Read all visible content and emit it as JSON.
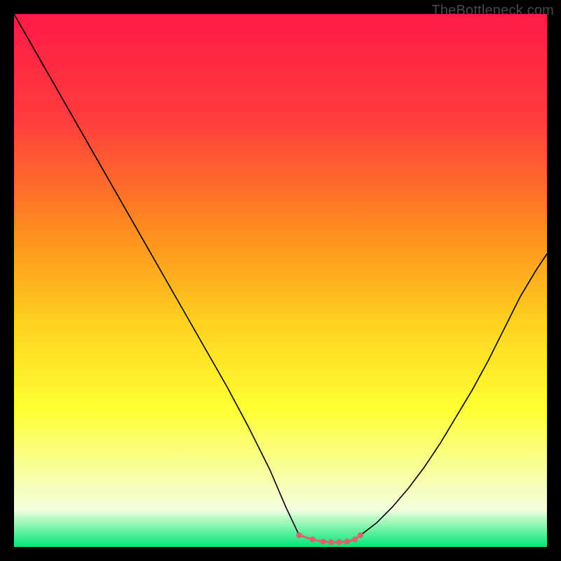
{
  "watermark": "TheBottleneck.com",
  "chart_data": {
    "type": "line",
    "title": "",
    "xlabel": "",
    "ylabel": "",
    "xlim": [
      0,
      100
    ],
    "ylim": [
      0,
      100
    ],
    "gradient_stops": [
      {
        "offset": 0,
        "color": "#ff1a47"
      },
      {
        "offset": 20,
        "color": "#ff3d3d"
      },
      {
        "offset": 40,
        "color": "#ff8a1f"
      },
      {
        "offset": 58,
        "color": "#ffd21f"
      },
      {
        "offset": 74,
        "color": "#ffff33"
      },
      {
        "offset": 86,
        "color": "#f8ffa0"
      },
      {
        "offset": 93,
        "color": "#f4ffdf"
      },
      {
        "offset": 100,
        "color": "#00e676"
      }
    ],
    "series": [
      {
        "name": "left-curve",
        "color": "#000000",
        "stroke_width": 1.6,
        "x": [
          0,
          4,
          8,
          12,
          16,
          20,
          24,
          28,
          32,
          36,
          40,
          44,
          48,
          51,
          53.5
        ],
        "y": [
          100,
          93,
          86,
          79,
          72,
          65,
          58,
          51,
          44,
          37,
          30,
          22.5,
          14.5,
          7.5,
          2.2
        ]
      },
      {
        "name": "right-curve",
        "color": "#000000",
        "stroke_width": 1.6,
        "x": [
          65,
          68,
          71,
          74,
          77,
          80,
          83,
          86,
          89,
          92,
          95,
          98,
          100
        ],
        "y": [
          2.2,
          4.5,
          7.5,
          11,
          15,
          19.5,
          24.5,
          29.5,
          35,
          41,
          47,
          52,
          55
        ]
      },
      {
        "name": "bottom-markers",
        "type": "scatter",
        "color": "#d9646b",
        "radius": 4.2,
        "x": [
          53.5,
          56,
          58,
          59.5,
          61,
          62.5,
          64,
          65
        ],
        "y": [
          2.2,
          1.4,
          1.0,
          0.9,
          0.9,
          1.0,
          1.4,
          2.2
        ]
      }
    ]
  }
}
